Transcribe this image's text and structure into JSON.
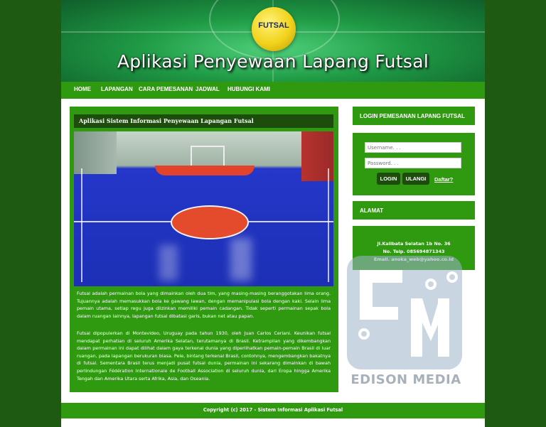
{
  "banner": {
    "ball_label": "FUTSAL",
    "title": "Aplikasi Penyewaan Lapang Futsal"
  },
  "nav": {
    "items": [
      {
        "label": "HOME"
      },
      {
        "label": "LAPANGAN"
      },
      {
        "label": "CARA PEMESANAN"
      },
      {
        "label": "JADWAL"
      },
      {
        "label": "HUBUNGI KAMI"
      }
    ]
  },
  "main": {
    "heading": "Aplikasi Sistem Informasi Penyewaan Lapangan Futsal",
    "paragraph1": "Futsal adalah permainan bola yang dimainkan oleh dua tim, yang masing-masing beranggotakan lima orang. Tujuannya adalah memasukkan bola ke gawang lawan, dengan memanipulasi bola dengan kaki. Selain lima pemain utama, setiap regu juga diizinkan memiliki pemain cadangan. Tidak seperti permainan sepak bola dalam ruangan lainnya, lapangan futsal dibatasi garis, bukan net atau papan.",
    "paragraph2": "Futsal dipopulerkan di Montevideo, Uruguay pada tahun 1930, oleh Juan Carlos Ceriani. Keunikan futsal mendapat perhatian di seluruh Amerika Selatan, terutamanya di Brasil. Ketrampilan yang dikembangkan dalam permainan ini dapat dilihat dalam gaya terkenal dunia yang diperlihatkan pemain-pemain Brasil di luar ruangan, pada lapangan berukuran biasa. Pele, bintang terkenal Brasil, contohnya, mengembangkan bakatnya di futsal. Sementara Brasil terus menjadi pusat futsal dunia, permainan ini sekarang dimainkan di bawah perlindungan Fédération Internationale de Football Association di seluruh dunia, dari Eropa hingga Amerika Tengah dan Amerika Utara serta Afrika, Asia, dan Oseania."
  },
  "login": {
    "heading": "LOGIN PEMESANAN LAPANG FUTSAL",
    "username_placeholder": "Username. . .",
    "password_placeholder": "Password. . .",
    "login_label": "LOGIN",
    "reset_label": "ULANGI",
    "register_label": "Daftar?"
  },
  "address": {
    "heading": "ALAMAT",
    "line1": "Jl.Kalibata Selatan 1b No. 36",
    "line2": "No. Telp. 085694871343",
    "line3": "Email. anoka_web@yahoo.co.id"
  },
  "footer": {
    "text": "Copyright (c) 2017 - Sistem Informasi Aplikasi Futsal"
  },
  "watermark": {
    "logo_text": "EM",
    "text": "EDISON MEDIA"
  },
  "colors": {
    "background": "#1e5a12",
    "accent_green": "#2f9a10",
    "dark_green": "#1d4d0c"
  }
}
